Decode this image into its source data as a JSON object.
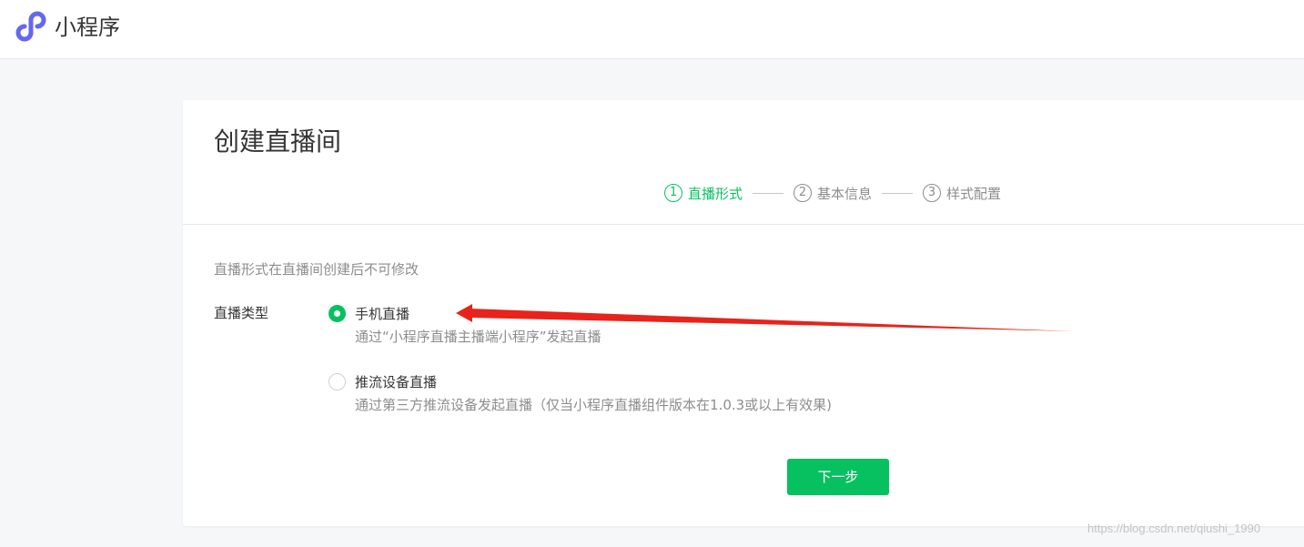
{
  "header": {
    "app_title": "小程序",
    "logo_icon": "mini-program-logo-icon",
    "logo_color": "#6467f0"
  },
  "page": {
    "title": "创建直播间",
    "steps": [
      {
        "num": "1",
        "label": "直播形式",
        "active": true
      },
      {
        "num": "2",
        "label": "基本信息",
        "active": false
      },
      {
        "num": "3",
        "label": "样式配置",
        "active": false
      }
    ],
    "hint": "直播形式在直播间创建后不可修改",
    "field_label": "直播类型",
    "options": [
      {
        "label": "手机直播",
        "description": "通过“小程序直播主播端小程序”发起直播",
        "selected": true
      },
      {
        "label": "推流设备直播",
        "description": "通过第三方推流设备发起直播（仅当小程序直播组件版本在1.0.3或以上有效果)",
        "selected": false
      }
    ],
    "next_label": "下一步"
  },
  "annotation": {
    "arrow_color": "#e8231b"
  },
  "watermark": "https://blog.csdn.net/qiushi_1990",
  "colors": {
    "accent": "#07c160",
    "muted": "#8d8d8d",
    "text": "#353535"
  }
}
